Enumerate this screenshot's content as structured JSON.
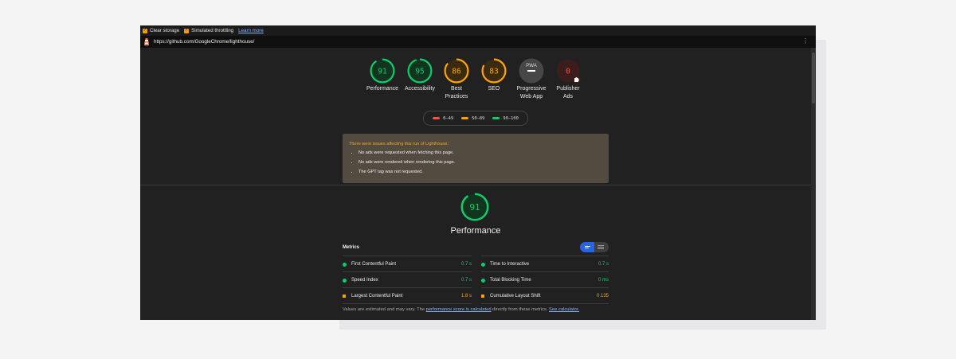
{
  "toolbar": {
    "clear_storage": "Clear storage",
    "simulated_throttling": "Simulated throttling",
    "learn_more": "Learn more"
  },
  "url": "https://github.com/GoogleChrome/lighthouse/",
  "menu_glyph": "⋮",
  "colors": {
    "pass": "#0cce6b",
    "average": "#ffa400",
    "fail": "#ff4e42",
    "link": "#8ab4f8",
    "toggle_active": "#2563e8"
  },
  "categories": [
    {
      "score": "91",
      "score_value": 91,
      "label_lines": [
        "Performance"
      ],
      "status": "pass"
    },
    {
      "score": "95",
      "score_value": 95,
      "label_lines": [
        "Accessibility"
      ],
      "status": "pass"
    },
    {
      "score": "86",
      "score_value": 86,
      "label_lines": [
        "Best",
        "Practices"
      ],
      "status": "average"
    },
    {
      "score": "83",
      "score_value": 83,
      "label_lines": [
        "SEO"
      ],
      "status": "average"
    },
    {
      "badge": "PWA",
      "label_lines": [
        "Progressive",
        "Web App"
      ],
      "status": "pwa"
    },
    {
      "score": "0",
      "score_value": 0,
      "label_lines": [
        "Publisher",
        "Ads"
      ],
      "status": "fail",
      "plugin_icon": "puzzle-icon"
    }
  ],
  "legend": [
    {
      "range": "0–49",
      "color": "#ff4e42"
    },
    {
      "range": "50–89",
      "color": "#ffa400"
    },
    {
      "range": "90–100",
      "color": "#0cce6b"
    }
  ],
  "warning": {
    "title": "There were issues affecting this run of Lighthouse:",
    "items": [
      "No ads were requested when fetching this page.",
      "No ads were rendered when rendering this page.",
      "The GPT tag was not requested."
    ]
  },
  "performance": {
    "score": "91",
    "score_value": 91,
    "title": "Performance"
  },
  "metrics": {
    "heading": "Metrics",
    "items": [
      {
        "name": "First Contentful Paint",
        "value": "0.7 s",
        "status": "pass"
      },
      {
        "name": "Time to Interactive",
        "value": "0.7 s",
        "status": "pass"
      },
      {
        "name": "Speed Index",
        "value": "0.7 s",
        "status": "pass"
      },
      {
        "name": "Total Blocking Time",
        "value": "0 ms",
        "status": "pass"
      },
      {
        "name": "Largest Contentful Paint",
        "value": "1.8 s",
        "status": "average"
      },
      {
        "name": "Cumulative Layout Shift",
        "value": "0.135",
        "status": "average"
      }
    ]
  },
  "footer": {
    "prefix": "Values are estimated and may vary. The ",
    "link1": "performance score is calculated",
    "middle": " directly from these metrics. ",
    "link2": "See calculator."
  }
}
